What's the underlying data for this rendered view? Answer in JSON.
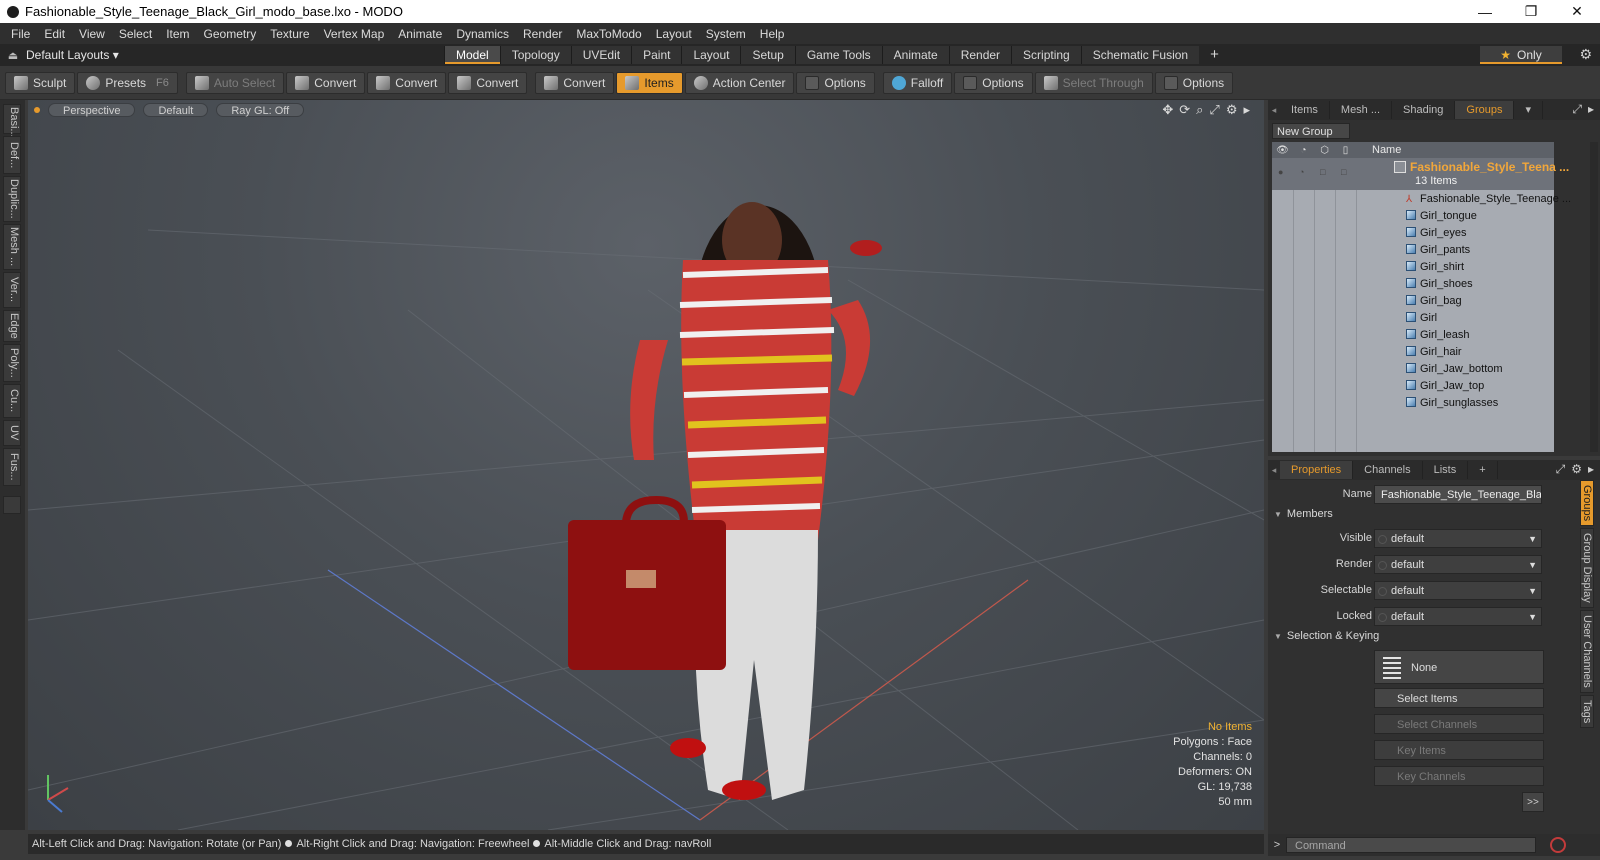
{
  "window": {
    "title": "Fashionable_Style_Teenage_Black_Girl_modo_base.lxo - MODO",
    "controls": [
      "—",
      "❐",
      "✕"
    ]
  },
  "menu": [
    "File",
    "Edit",
    "View",
    "Select",
    "Item",
    "Geometry",
    "Texture",
    "Vertex Map",
    "Animate",
    "Dynamics",
    "Render",
    "MaxToModo",
    "Layout",
    "System",
    "Help"
  ],
  "layout_bar": {
    "layouts_label": "Default Layouts ▾",
    "tabs": [
      "Model",
      "Topology",
      "UVEdit",
      "Paint",
      "Layout",
      "Setup",
      "Game Tools",
      "Animate",
      "Render",
      "Scripting",
      "Schematic Fusion"
    ],
    "active_tab": "Model",
    "add_tab": "+",
    "only_label": "Only"
  },
  "toolbar": {
    "sculpt": "Sculpt",
    "presets": "Presets",
    "presets_key": "F6",
    "auto_select": "Auto Select",
    "convert": "Convert",
    "items": "Items",
    "action_center": "Action Center",
    "options": "Options",
    "falloff": "Falloff",
    "select_through": "Select Through"
  },
  "left_tabs": [
    "Basi...",
    "Def...",
    "Duplic...",
    "Mesh ...",
    "Ver...",
    "Edge",
    "Poly...",
    "Cu...",
    "UV",
    "Fus..."
  ],
  "viewport": {
    "view": "Perspective",
    "shading": "Default",
    "raygl": "Ray GL: Off",
    "info": {
      "selection": "No Items",
      "polygons": "Polygons : Face",
      "channels": "Channels: 0",
      "deformers": "Deformers: ON",
      "gl": "GL: 19,738",
      "focal": "50 mm"
    }
  },
  "status": {
    "hint1": "Alt-Left Click and Drag: Navigation: Rotate (or Pan)",
    "hint2": "Alt-Right Click and Drag: Navigation: Freewheel",
    "hint3": "Alt-Middle Click and Drag: navRoll"
  },
  "groups_panel": {
    "tabs": [
      "Items",
      "Mesh ...",
      "Shading",
      "Groups"
    ],
    "active_tab": "Groups",
    "new_group": "New Group",
    "name_header": "Name",
    "group_name": "Fashionable_Style_Teena ...",
    "group_count": "13 Items",
    "items": [
      {
        "label": "Fashionable_Style_Teenage ...",
        "kind": "bone"
      },
      {
        "label": "Girl_tongue",
        "kind": "mesh"
      },
      {
        "label": "Girl_eyes",
        "kind": "mesh"
      },
      {
        "label": "Girl_pants",
        "kind": "mesh"
      },
      {
        "label": "Girl_shirt",
        "kind": "mesh"
      },
      {
        "label": "Girl_shoes",
        "kind": "mesh"
      },
      {
        "label": "Girl_bag",
        "kind": "mesh"
      },
      {
        "label": "Girl",
        "kind": "mesh"
      },
      {
        "label": "Girl_leash",
        "kind": "mesh"
      },
      {
        "label": "Girl_hair",
        "kind": "mesh"
      },
      {
        "label": "Girl_Jaw_bottom",
        "kind": "mesh"
      },
      {
        "label": "Girl_Jaw_top",
        "kind": "mesh"
      },
      {
        "label": "Girl_sunglasses",
        "kind": "mesh"
      }
    ]
  },
  "properties_panel": {
    "tabs": [
      "Properties",
      "Channels",
      "Lists"
    ],
    "active_tab": "Properties",
    "add_tab": "+",
    "name_label": "Name",
    "name_value": "Fashionable_Style_Teenage_Blac",
    "members_section": "Members",
    "visible_label": "Visible",
    "visible_value": "default",
    "render_label": "Render",
    "render_value": "default",
    "selectable_label": "Selectable",
    "selectable_value": "default",
    "locked_label": "Locked",
    "locked_value": "default",
    "selkey_section": "Selection & Keying",
    "none_btn": "None",
    "select_items": "Select Items",
    "select_channels": "Select Channels",
    "key_items": "Key Items",
    "key_channels": "Key Channels",
    "more": ">>",
    "side_tabs": [
      "Groups",
      "Group Display",
      "User Channels",
      "Tags"
    ]
  },
  "command": {
    "placeholder": "Command",
    "chevron": ">"
  },
  "colors": {
    "accent": "#e69a2c",
    "viewport_bg": "#4a4f55"
  }
}
